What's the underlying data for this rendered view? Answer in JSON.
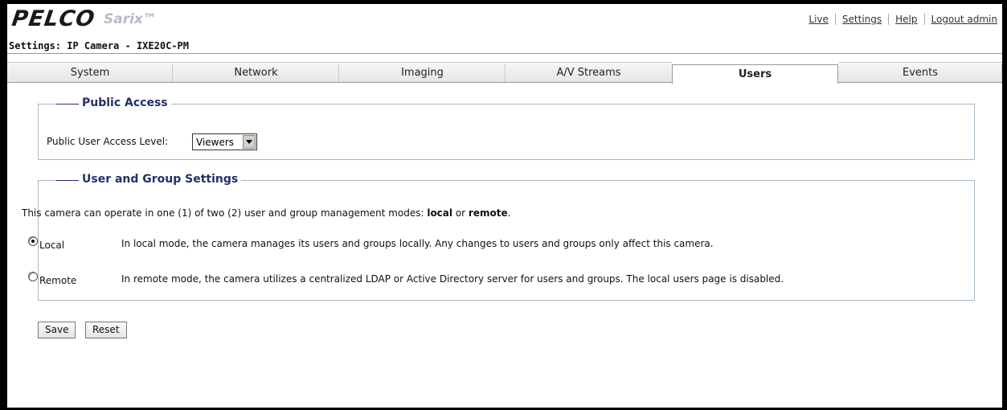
{
  "header": {
    "logo": "PELCO",
    "product": "Sarix™",
    "links": [
      "Live",
      "Settings",
      "Help",
      "Logout admin"
    ]
  },
  "subtitle": "Settings: IP Camera - IXE20C-PM",
  "tabs": [
    {
      "label": "System",
      "active": false
    },
    {
      "label": "Network",
      "active": false
    },
    {
      "label": "Imaging",
      "active": false
    },
    {
      "label": "A/V Streams",
      "active": false
    },
    {
      "label": "Users",
      "active": true
    },
    {
      "label": "Events",
      "active": false
    }
  ],
  "public_access": {
    "legend": "Public Access",
    "level_label": "Public User Access Level:",
    "level_value": "Viewers"
  },
  "user_group": {
    "legend": "User and Group Settings",
    "intro_pre": "This camera can operate in one (1) of two (2) user and group management modes: ",
    "intro_local": "local",
    "intro_or": " or ",
    "intro_remote": "remote",
    "intro_end": ".",
    "modes": [
      {
        "label": "Local",
        "checked": true,
        "description": "In local mode, the camera manages its users and groups locally. Any changes to users and groups only affect this camera."
      },
      {
        "label": "Remote",
        "checked": false,
        "description": "In remote mode, the camera utilizes a centralized LDAP or Active Directory server for users and groups. The local users page is disabled."
      }
    ]
  },
  "buttons": {
    "save": "Save",
    "reset": "Reset"
  }
}
